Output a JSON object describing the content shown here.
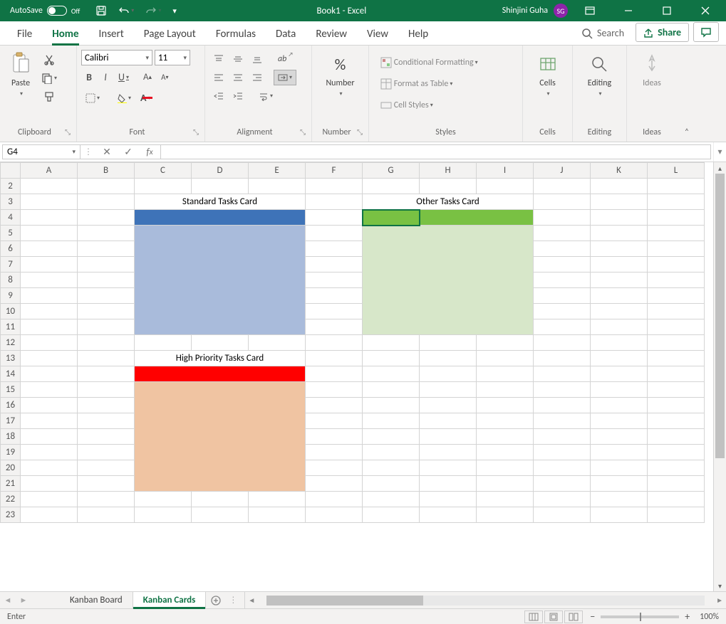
{
  "titlebar": {
    "autosave_label": "AutoSave",
    "autosave_state": "Off",
    "doc_title": "Book1  -  Excel",
    "user_name": "Shinjini Guha",
    "user_initials": "SG"
  },
  "tabs": {
    "file": "File",
    "home": "Home",
    "insert": "Insert",
    "page_layout": "Page Layout",
    "formulas": "Formulas",
    "data": "Data",
    "review": "Review",
    "view": "View",
    "help": "Help",
    "search": "Search",
    "share": "Share"
  },
  "ribbon": {
    "clipboard": {
      "label": "Clipboard",
      "paste": "Paste"
    },
    "font": {
      "label": "Font",
      "name": "Calibri",
      "size": "11"
    },
    "alignment": {
      "label": "Alignment"
    },
    "number": {
      "label": "Number",
      "btn": "Number"
    },
    "styles": {
      "label": "Styles",
      "cond": "Conditional Formatting",
      "table": "Format as Table",
      "cell": "Cell Styles"
    },
    "cells": {
      "label": "Cells",
      "btn": "Cells"
    },
    "editing": {
      "label": "Editing",
      "btn": "Editing"
    },
    "ideas": {
      "label": "Ideas",
      "btn": "Ideas"
    }
  },
  "fx": {
    "namebox": "G4",
    "formula": ""
  },
  "sheet": {
    "columns": [
      "A",
      "B",
      "C",
      "D",
      "E",
      "F",
      "G",
      "H",
      "I",
      "J",
      "K",
      "L"
    ],
    "rows": [
      2,
      3,
      4,
      5,
      6,
      7,
      8,
      9,
      10,
      11,
      12,
      13,
      14,
      15,
      16,
      17,
      18,
      19,
      20,
      21,
      22,
      23
    ],
    "cards": {
      "standard_title": "Standard Tasks Card",
      "other_title": "Other Tasks Card",
      "high_title": "High Priority Tasks Card"
    },
    "selected_cell": "G4"
  },
  "sheettabs": {
    "tab1": "Kanban Board",
    "tab2": "Kanban Cards"
  },
  "status": {
    "mode": "Enter",
    "zoom": "100%"
  }
}
